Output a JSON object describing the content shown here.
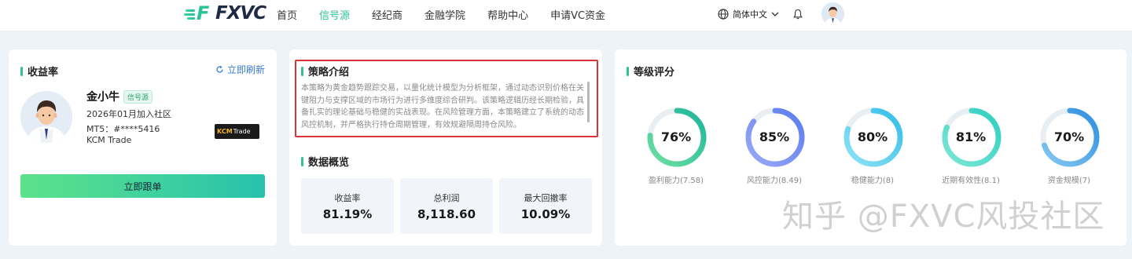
{
  "nav": {
    "logo_text": "FXVC",
    "items": [
      {
        "label": "首页",
        "active": false
      },
      {
        "label": "信号源",
        "active": true
      },
      {
        "label": "经纪商",
        "active": false
      },
      {
        "label": "金融学院",
        "active": false
      },
      {
        "label": "帮助中心",
        "active": false
      },
      {
        "label": "申请VC资金",
        "active": false
      }
    ],
    "language": "简体中文"
  },
  "profile": {
    "section_title": "收益率",
    "refresh_label": "立即刷新",
    "name": "金小牛",
    "tag": "信号源",
    "joined": "2026年01月加入社区",
    "mt5": "MT5：#****5416",
    "broker": "KCM Trade",
    "broker_logo_text": [
      "KCM",
      "Trade"
    ],
    "follow_button": "立即跟单"
  },
  "strategy": {
    "title": "策略介绍",
    "text": "本策略为黄金趋势跟踪交易，以量化统计模型为分析框架，通过动态识别价格在关键阻力与支撑区域的市场行为进行多维度综合研判。该策略逻辑历经长期检验，具备扎实的理论基础与稳健的实战表现。在风险管理方面，本策略建立了系统的动态风控机制，并严格执行持仓周期管理，有效规避隔周持仓风险。"
  },
  "overview": {
    "title": "数据概览",
    "stats": [
      {
        "label": "收益率",
        "value": "81.19%"
      },
      {
        "label": "总利润",
        "value": "8,118.60"
      },
      {
        "label": "最大回撤率",
        "value": "10.09%"
      }
    ]
  },
  "rating": {
    "title": "等级评分",
    "gauges": [
      {
        "percent": 76,
        "label": "盈利能力(7.58)",
        "color_start": "#6ee0a0",
        "color_end": "#1db59a"
      },
      {
        "percent": 85,
        "label": "风控能力(8.49)",
        "color_start": "#9aa9f5",
        "color_end": "#5b7cf0"
      },
      {
        "percent": 80,
        "label": "稳健能力(8)",
        "color_start": "#8fe3f5",
        "color_end": "#34bde8"
      },
      {
        "percent": 81,
        "label": "近期有效性(8.1)",
        "color_start": "#7ee6d6",
        "color_end": "#2fcfc0"
      },
      {
        "percent": 70,
        "label": "资金规模(7)",
        "color_start": "#86c8f2",
        "color_end": "#2d8fe0"
      }
    ]
  },
  "watermark": "知乎 @FXVC风投社区"
}
